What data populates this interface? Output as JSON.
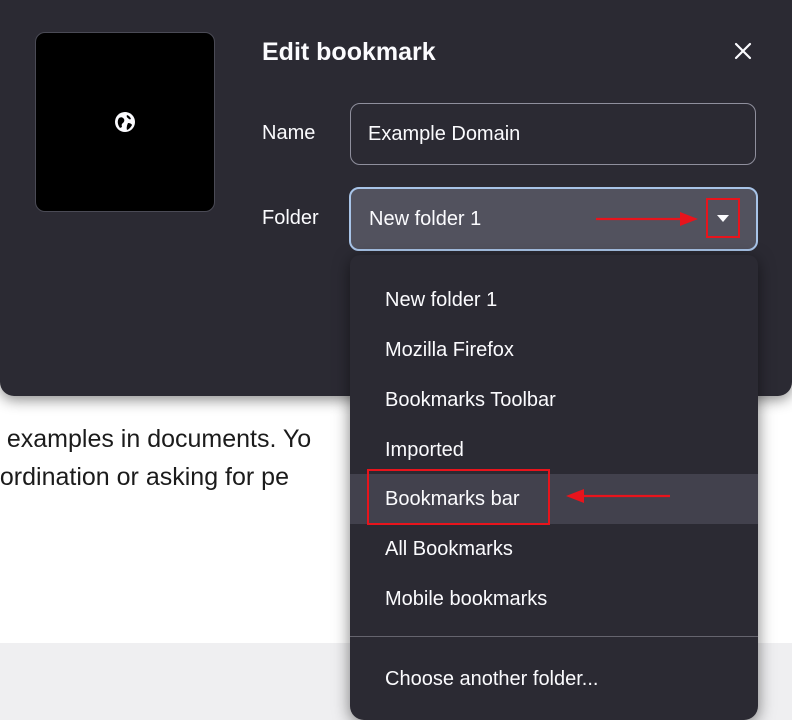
{
  "page": {
    "text_lines": [
      "e examples in documents. Yo",
      "oordination or asking for pe"
    ]
  },
  "dialog": {
    "title": "Edit bookmark",
    "close_icon": "close-icon",
    "thumbnail_icon": "globe-icon",
    "name_label": "Name",
    "name_value": "Example Domain",
    "folder_label": "Folder",
    "folder_value": "New folder 1"
  },
  "menu": {
    "items": [
      "New folder 1",
      "Mozilla Firefox",
      "Bookmarks Toolbar",
      "Imported",
      "Bookmarks bar",
      "All Bookmarks",
      "Mobile bookmarks"
    ],
    "selected": "Bookmarks bar",
    "choose_another": "Choose another folder..."
  },
  "colors": {
    "dialog_bg": "#2b2a33",
    "select_bg": "#52525e",
    "focus_ring": "#a8c4e8",
    "annotation": "#e8141c"
  }
}
